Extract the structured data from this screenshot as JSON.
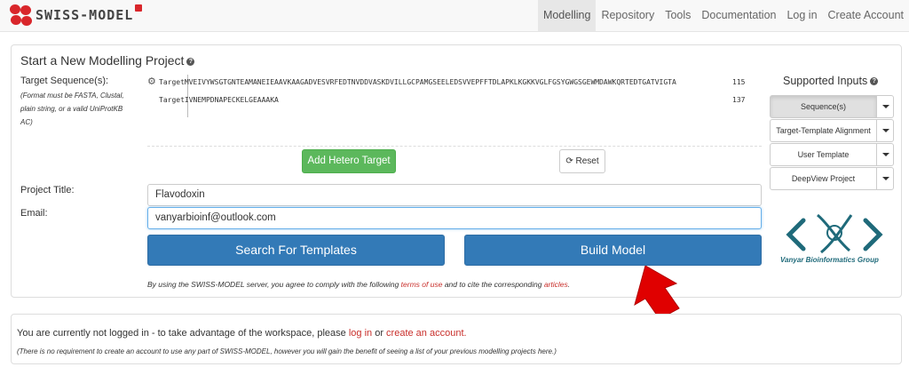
{
  "brand": {
    "name": "SWISS-MODEL"
  },
  "nav": {
    "items": [
      {
        "label": "Modelling",
        "active": true
      },
      {
        "label": "Repository"
      },
      {
        "label": "Tools"
      },
      {
        "label": "Documentation"
      },
      {
        "label": "Log in"
      },
      {
        "label": "Create Account"
      }
    ]
  },
  "project": {
    "title": "Start a New Modelling Project",
    "target_label": "Target Sequence(s):",
    "target_note": "(Format must be FASTA, Clustal, plain string, or a valid UniProtKB AC)",
    "sequences": [
      {
        "name": "Target",
        "residues": "MVEIVYWSGTGNTEAMANEIEAAVKAAGADVESVRFEDTNVDDVASKDVILLGCPAMGSEELEDSVVEPFFTDLAPKLKGKKVGLFGSYGWGSGEWMDAWKQRTEDTGATVIGTA",
        "length": "115"
      },
      {
        "name": "Target",
        "residues": "IVNEMPDNAPECKELGEAAAKA",
        "length": "137"
      }
    ],
    "add_hetero_label": "Add Hetero Target",
    "reset_label": "Reset",
    "project_title_label": "Project Title:",
    "project_title_value": "Flavodoxin",
    "email_label": "Email:",
    "email_value": "vanyarbioinf@outlook.com",
    "search_label": "Search For Templates",
    "build_label": "Build Model",
    "disclaimer_pre": "By using the SWISS-MODEL server, you agree to comply with the following ",
    "terms_link": "terms of use",
    "disclaimer_mid": " and to cite the corresponding ",
    "articles_link": "articles",
    "disclaimer_end": "."
  },
  "supported_inputs": {
    "title": "Supported Inputs",
    "options": [
      {
        "label": "Sequence(s)",
        "active": true
      },
      {
        "label": "Target-Template Alignment"
      },
      {
        "label": "User Template"
      },
      {
        "label": "DeepView Project"
      }
    ]
  },
  "watermark": {
    "text": "Vanyar Bioinformatics Group",
    "color": "#1f6a7a"
  },
  "login": {
    "text_pre": "You are currently not logged in - to take advantage of the workspace, please ",
    "login_link": "log in",
    "text_mid": " or ",
    "create_link": "create an account.",
    "note": "(There is no requirement to create an account to use any part of SWISS-MODEL, however you will gain the benefit of seeing a list of your previous modelling projects here.)"
  },
  "colors": {
    "brand_red": "#d9262b",
    "primary": "#337ab7",
    "success": "#5cb85c",
    "arrow": "#e00000"
  }
}
